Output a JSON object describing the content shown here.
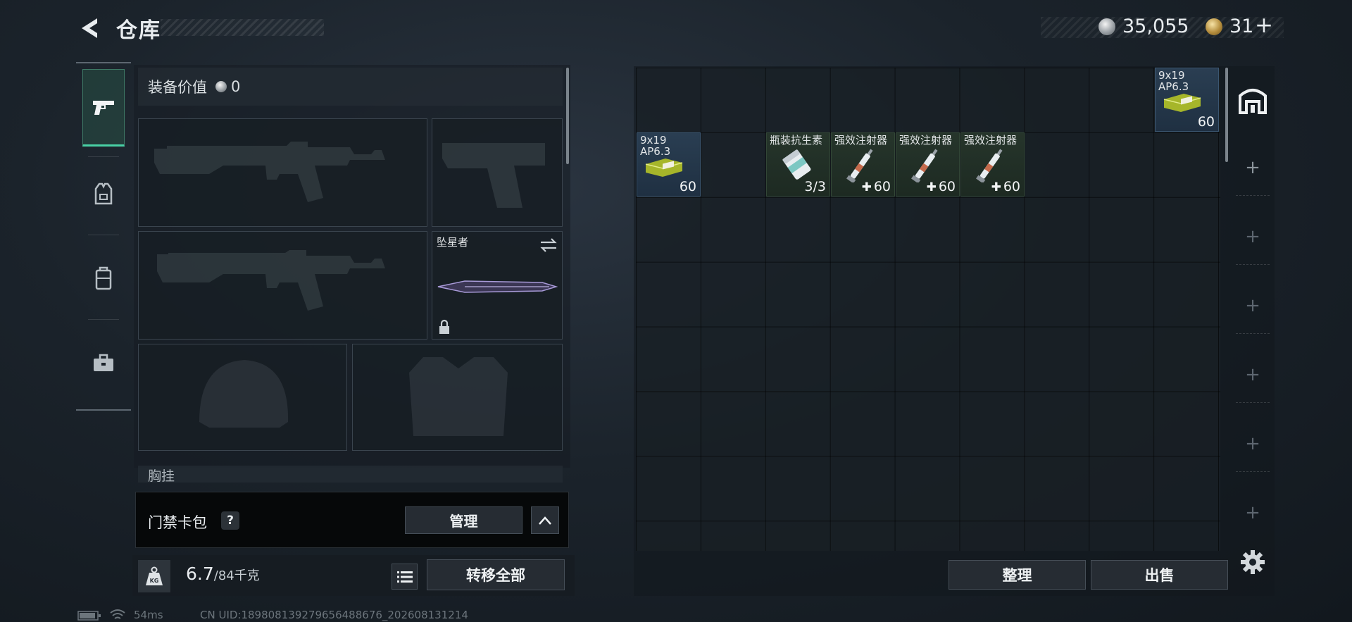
{
  "header": {
    "title": "仓库"
  },
  "currency": {
    "silver": "35,055",
    "gold": "31",
    "gold_plus": "+"
  },
  "equipment": {
    "value_label": "装备价值",
    "value": "0",
    "melee_slot_name": "坠星者",
    "chest_rig_label": "胸挂"
  },
  "keycard": {
    "label": "门禁卡包",
    "help": "?",
    "manage_label": "管理"
  },
  "weight": {
    "current": "6.7",
    "max": "/84千克",
    "icon_text": "KG"
  },
  "transfer_all_label": "转移全部",
  "storage": {
    "items": [
      {
        "label": "9x19\nAP6.3",
        "count": "60",
        "style": "blue",
        "icon": "ammo-box-icon"
      },
      {
        "label": "9x19\nAP6.3",
        "count": "60",
        "style": "blue",
        "icon": "ammo-box-icon"
      },
      {
        "label": "瓶装抗生素",
        "count": "3/3",
        "style": "green",
        "icon": "pill-bottle-icon"
      },
      {
        "label": "强效注射器",
        "count": "60",
        "style": "green",
        "icon": "syringe-icon"
      },
      {
        "label": "强效注射器",
        "count": "60",
        "style": "green",
        "icon": "syringe-icon"
      },
      {
        "label": "强效注射器",
        "count": "60",
        "style": "green",
        "icon": "syringe-icon"
      }
    ],
    "sort_label": "整理",
    "sell_label": "出售"
  },
  "status_bar": {
    "ping": "54ms",
    "uid": "CN UID:18980813927965648867​6_202608131214"
  },
  "colors": {
    "accent_green": "#49d1a5",
    "ammo_blue": "#2a3e52",
    "med_green": "#26352b"
  }
}
